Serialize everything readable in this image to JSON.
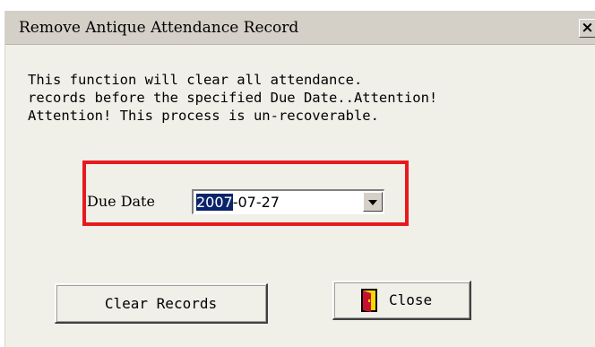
{
  "window": {
    "title": "Remove Antique Attendance Record",
    "close_glyph": "×"
  },
  "message": {
    "lines": [
      "This function will clear all attendance.",
      "records before the specified Due Date..Attention!",
      "Attention! This process is un-recoverable."
    ]
  },
  "due_date": {
    "label": "Due Date",
    "year_selected": "2007",
    "rest": "-07-27",
    "dropdown_icon": "chevron-down-icon"
  },
  "buttons": {
    "clear_label": "Clear Records",
    "close_label": "Close",
    "close_icon": "door-icon"
  },
  "colors": {
    "highlight_box": "#e8191e",
    "selection": "#0a246a",
    "door_yellow": "#f5d800",
    "door_red": "#c8102e"
  }
}
